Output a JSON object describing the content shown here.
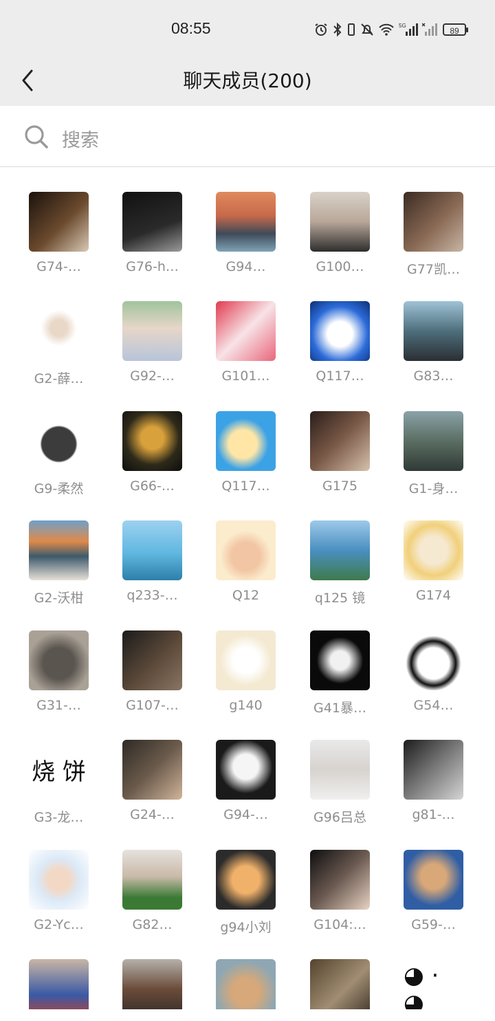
{
  "status": {
    "time": "08:55",
    "battery": "89"
  },
  "header": {
    "title": "聊天成员(200)"
  },
  "search": {
    "placeholder": "搜索"
  },
  "members": [
    {
      "name": "G74-…",
      "bg": "linear-gradient(135deg,#1b120c,#6b4a2e 55%,#d8c9b5)"
    },
    {
      "name": "G76-h…",
      "bg": "linear-gradient(160deg,#111,#2a2a2a 60%,#9a9a9a)"
    },
    {
      "name": "G94…",
      "bg": "linear-gradient(180deg,#e08a5d,#c7694a 40%,#3f4a59 70%,#7fa3b7)"
    },
    {
      "name": "G100…",
      "bg": "linear-gradient(180deg,#d9d1c8,#b8a799 50%,#2d2d2d)"
    },
    {
      "name": "G77凯…",
      "bg": "linear-gradient(135deg,#3b2b22,#8a6a55 55%,#c7b5a4)"
    },
    {
      "name": "G2-薛…",
      "bg": "radial-gradient(circle at 50% 45%,#e9d7c7 18%,#ffffff 40%)"
    },
    {
      "name": "G92-…",
      "bg": "linear-gradient(180deg,#9fc49b,#e7d6c9 45%,#b7c5d9)"
    },
    {
      "name": "G101…",
      "bg": "linear-gradient(135deg,#e23a4f,#f7e3e7 50%,#e9667a)"
    },
    {
      "name": "Q117…",
      "bg": "radial-gradient(circle at 50% 55%,#ffffff 28%,#2c6bd8 62%,#0c2f74)"
    },
    {
      "name": "G83…",
      "bg": "linear-gradient(180deg,#9fc3d6,#4e6e7c 50%,#2a2f33)"
    },
    {
      "name": "G9-柔然",
      "bg": "radial-gradient(circle at 50% 55%,#3c3c3c 38%,#ffffff 42%)"
    },
    {
      "name": "G66-…",
      "bg": "radial-gradient(circle at 50% 45%,#d9a13b 25%,#2e2a1a 60%,#0d0d0d)"
    },
    {
      "name": "Q117…",
      "bg": "radial-gradient(circle at 45% 55%,#ffe6a6 30%,#3ca2e6 55%)"
    },
    {
      "name": "G175",
      "bg": "linear-gradient(135deg,#2a1e1a,#7b5a48 50%,#d6c1ad)"
    },
    {
      "name": "G1-身…",
      "bg": "linear-gradient(180deg,#8aa2a8,#5b6e63 50%,#2f3a36)"
    },
    {
      "name": "G2-沃柑",
      "bg": "linear-gradient(180deg,#6fa0c8,#e08a4a 35%,#3d5a6b 60%,#e7e0d9)"
    },
    {
      "name": "q233-…",
      "bg": "linear-gradient(180deg,#9dd1f0,#5fb7e0 55%,#2d7fa8)"
    },
    {
      "name": "Q12",
      "bg": "radial-gradient(circle at 50% 60%,#f2c6a4 30%,#fbeccd 55%)"
    },
    {
      "name": "q125 镜",
      "bg": "linear-gradient(180deg,#9ec9e8,#4a8fc1 50%,#3f7a4b)"
    },
    {
      "name": "G174",
      "bg": "radial-gradient(circle at 50% 50%,#f6e9d2 32%,#f1d07a 60%,#ffffff)"
    },
    {
      "name": "G31-…",
      "bg": "radial-gradient(circle at 50% 55%,#5a554f 35%,#a9a196 70%)"
    },
    {
      "name": "G107-…",
      "bg": "linear-gradient(135deg,#1b1b1b,#5c4a3a 55%,#8a7563)"
    },
    {
      "name": "g140",
      "bg": "radial-gradient(circle at 50% 50%,#ffffff 30%,#f4ead2 60%)"
    },
    {
      "name": "G41暴…",
      "bg": "radial-gradient(circle at 50% 50%,#f1f1f1 22%,#0a0a0a 55%)"
    },
    {
      "name": "G54…",
      "bg": "radial-gradient(circle at 50% 55%,#ffffff 35%,#111 50%,#ffffff 62%)"
    },
    {
      "name": "G3-龙…",
      "bg": "#ffffff",
      "glyph": "烧 饼"
    },
    {
      "name": "G24-…",
      "bg": "linear-gradient(135deg,#2f2a24,#6a5a4b 50%,#d0b49a)"
    },
    {
      "name": "G94-…",
      "bg": "radial-gradient(circle at 50% 45%,#f5f5f5 28%,#1a1a1a 60%)"
    },
    {
      "name": "G96吕总",
      "bg": "linear-gradient(180deg,#e9e9e9,#d7d3cf 50%,#f0efee)"
    },
    {
      "name": "g81-…",
      "bg": "linear-gradient(135deg,#1c1c1c,#7a7a7a 50%,#d5d5d5)"
    },
    {
      "name": "G2-Yc…",
      "bg": "radial-gradient(circle at 50% 50%,#f3d8c5 25%,#dbe9f7 50%,#ffffff)"
    },
    {
      "name": "G82…",
      "bg": "linear-gradient(180deg,#e6e2dd,#c9b9a8 45%,#3b7a35 80%)"
    },
    {
      "name": "g94小刘",
      "bg": "radial-gradient(circle at 50% 50%,#f0b16a 32%,#2b2b2b 70%)"
    },
    {
      "name": "G104:…",
      "bg": "linear-gradient(135deg,#0e0e0e,#6b5a51 50%,#e8d3c3)"
    },
    {
      "name": "G59-…",
      "bg": "radial-gradient(circle at 50% 45%,#d9a878 28%,#2f5ea5 65%)"
    },
    {
      "name": "",
      "bg": "linear-gradient(180deg,#c9b6a5,#3a59a5 60%,#c0412e)"
    },
    {
      "name": "",
      "bg": "linear-gradient(180deg,#b5b1aa,#6b4c3a 50%,#2f2a26)"
    },
    {
      "name": "",
      "bg": "radial-gradient(circle at 50% 55%,#d7a879 30%,#8ea7b3 70%)"
    },
    {
      "name": "",
      "bg": "linear-gradient(135deg,#55432e,#a08d72 55%,#3a2f26)"
    },
    {
      "name": "",
      "bg": "#ffffff",
      "glyph": "◕ · ◕"
    }
  ]
}
